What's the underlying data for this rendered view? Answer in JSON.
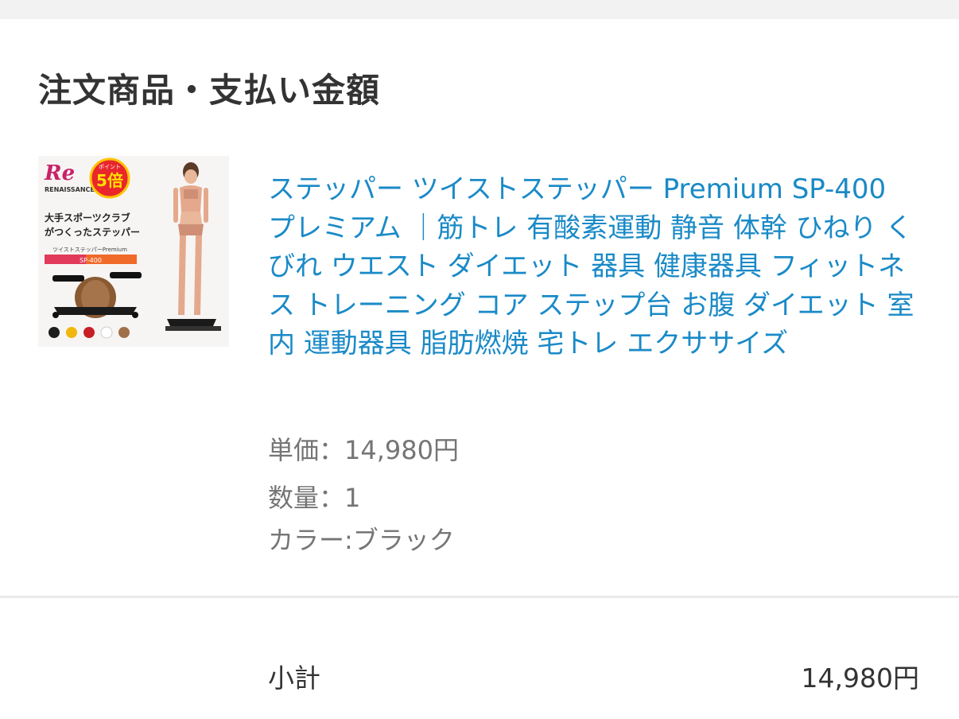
{
  "section": {
    "title": "注文商品・支払い金額"
  },
  "product": {
    "title": "ステッパー ツイストステッパー Premium SP-400 プレミアム ｜筋トレ 有酸素運動 静音 体幹 ひねり くびれ ウエスト ダイエット 器具 健康器具 フィットネス トレーニング コア ステップ台 お腹 ダイエット 室内 運動器具 脂肪燃焼 宅トレ エクササイズ",
    "image": {
      "brand_text": "RENAISSANCE",
      "badge_label": "ポイント",
      "badge_value": "5倍",
      "tagline_line1": "大手スポーツクラブ",
      "tagline_line2": "がつくったステッパー",
      "product_line": "ツイストステッパーPremium",
      "model": "SP-400",
      "swatch_colors": [
        "#1e1e1e",
        "#f2b70c",
        "#c81e28",
        "#ffffff",
        "#a0704a"
      ]
    },
    "unit_price": "単価：14,980円",
    "quantity": "数量：1",
    "color": "カラー:ブラック"
  },
  "summary": {
    "subtotal_label": "小計",
    "subtotal_value": "14,980円"
  },
  "colors": {
    "link": "#1a8ac7",
    "text": "#333333",
    "muted": "#757575",
    "divider": "#eaeaea"
  }
}
